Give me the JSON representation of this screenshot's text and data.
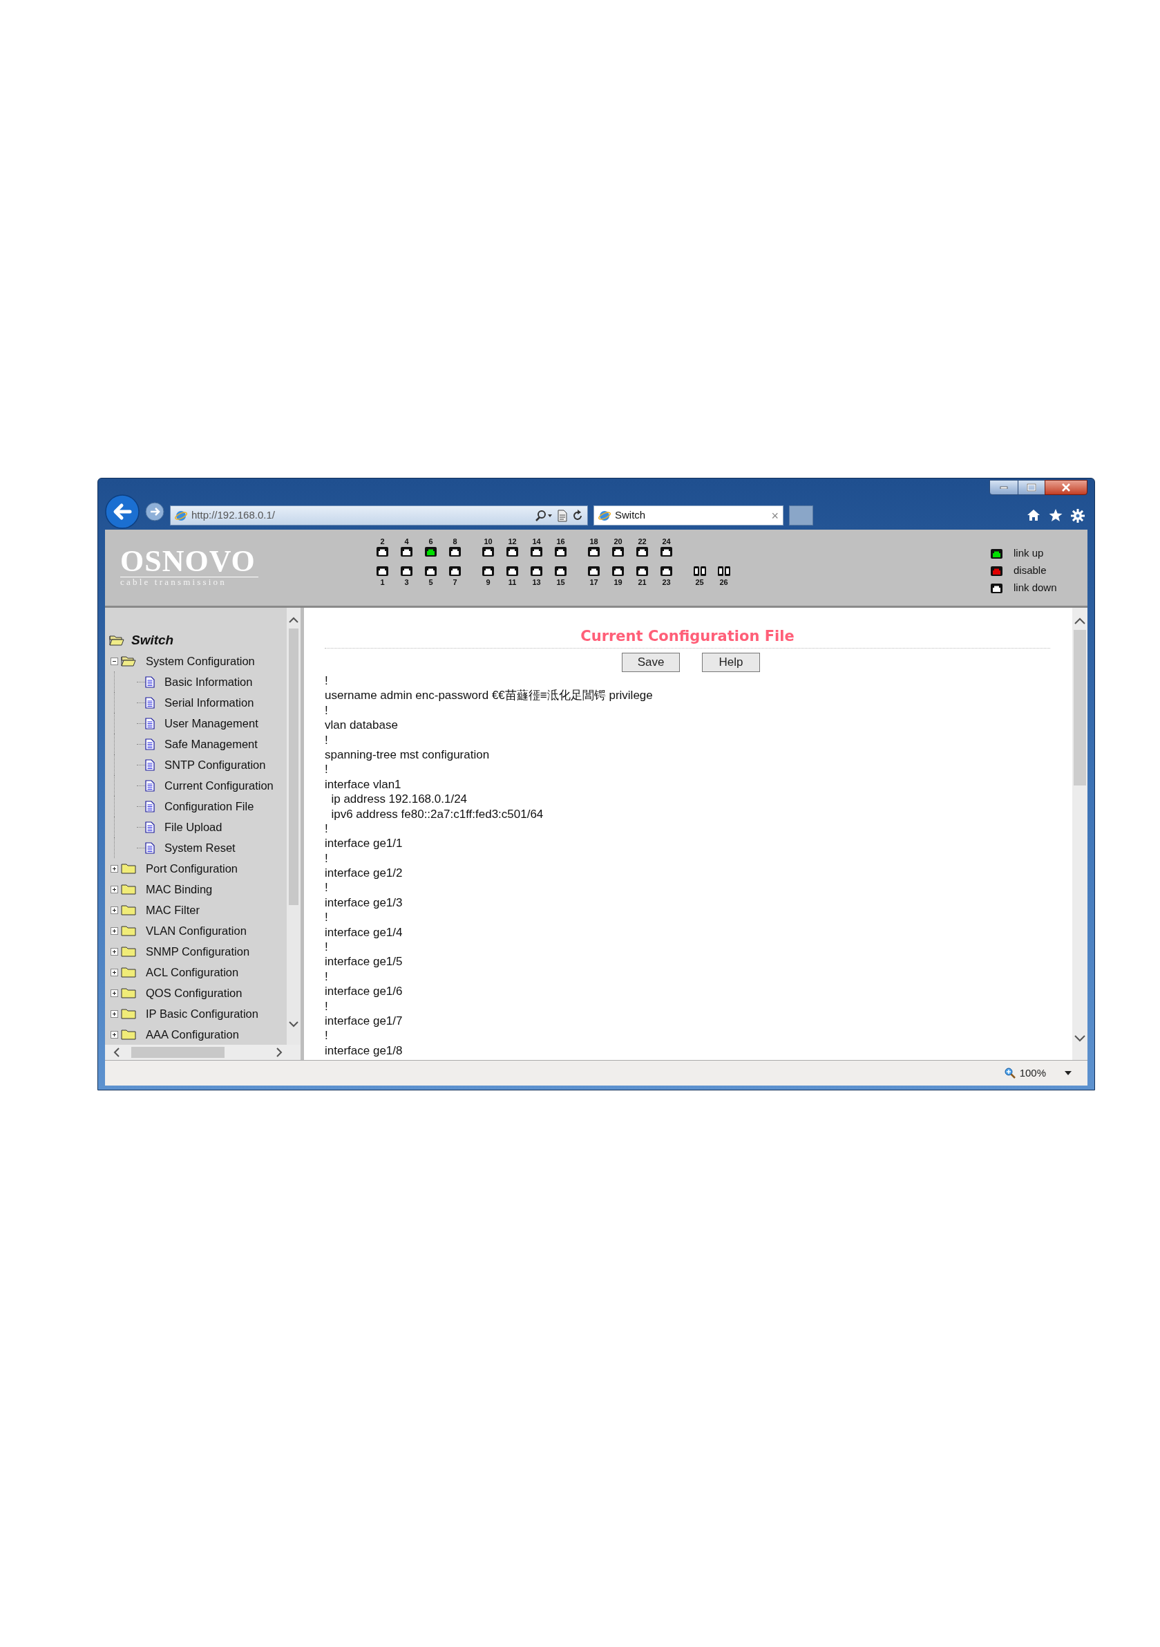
{
  "browser": {
    "address": "http://192.168.0.1/",
    "tabs": [
      {
        "title": "Switch",
        "close": "×"
      }
    ],
    "zoom": "100%"
  },
  "header": {
    "logo": "OSNOVO",
    "logo_tagline": "cable transmission",
    "port_columns": [
      {
        "kind": "rj45",
        "top": {
          "label": "2",
          "link_up": false
        },
        "bottom": {
          "label": "1",
          "link_up": false
        }
      },
      {
        "kind": "rj45",
        "top": {
          "label": "4",
          "link_up": false
        },
        "bottom": {
          "label": "3",
          "link_up": false
        }
      },
      {
        "kind": "rj45",
        "top": {
          "label": "6",
          "link_up": true
        },
        "bottom": {
          "label": "5",
          "link_up": false
        }
      },
      {
        "kind": "rj45",
        "top": {
          "label": "8",
          "link_up": false
        },
        "bottom": {
          "label": "7",
          "link_up": false
        }
      },
      {
        "kind": "rj45",
        "top": {
          "label": "10",
          "link_up": false
        },
        "bottom": {
          "label": "9",
          "link_up": false
        }
      },
      {
        "kind": "rj45",
        "top": {
          "label": "12",
          "link_up": false
        },
        "bottom": {
          "label": "11",
          "link_up": false
        }
      },
      {
        "kind": "rj45",
        "top": {
          "label": "14",
          "link_up": false
        },
        "bottom": {
          "label": "13",
          "link_up": false
        }
      },
      {
        "kind": "rj45",
        "top": {
          "label": "16",
          "link_up": false
        },
        "bottom": {
          "label": "15",
          "link_up": false
        }
      },
      {
        "kind": "rj45",
        "top": {
          "label": "18",
          "link_up": false
        },
        "bottom": {
          "label": "17",
          "link_up": false
        }
      },
      {
        "kind": "rj45",
        "top": {
          "label": "20",
          "link_up": false
        },
        "bottom": {
          "label": "19",
          "link_up": false
        }
      },
      {
        "kind": "rj45",
        "top": {
          "label": "22",
          "link_up": false
        },
        "bottom": {
          "label": "21",
          "link_up": false
        }
      },
      {
        "kind": "rj45",
        "top": {
          "label": "24",
          "link_up": false
        },
        "bottom": {
          "label": "23",
          "link_up": false
        }
      },
      {
        "kind": "sfp",
        "bottom": {
          "label": "25",
          "link_up": false
        }
      },
      {
        "kind": "sfp",
        "bottom": {
          "label": "26",
          "link_up": false
        }
      }
    ],
    "legend": [
      {
        "color": "#00e000",
        "label": "link up"
      },
      {
        "color": "#e00000",
        "label": "disable"
      },
      {
        "color": "#ffffff",
        "label": "link down"
      }
    ]
  },
  "sidebar": {
    "tree": {
      "label": "Switch",
      "expanded": true,
      "children": [
        {
          "label": "System Configuration",
          "expanded": true,
          "children": [
            {
              "label": "Basic Information"
            },
            {
              "label": "Serial Information"
            },
            {
              "label": "User Management"
            },
            {
              "label": "Safe Management"
            },
            {
              "label": "SNTP Configuration"
            },
            {
              "label": "Current Configuration"
            },
            {
              "label": "Configuration File"
            },
            {
              "label": "File Upload"
            },
            {
              "label": "System Reset"
            }
          ]
        },
        {
          "label": "Port Configuration",
          "expanded": false
        },
        {
          "label": "MAC Binding",
          "expanded": false
        },
        {
          "label": "MAC Filter",
          "expanded": false
        },
        {
          "label": "VLAN Configuration",
          "expanded": false
        },
        {
          "label": "SNMP Configuration",
          "expanded": false
        },
        {
          "label": "ACL Configuration",
          "expanded": false
        },
        {
          "label": "QOS Configuration",
          "expanded": false
        },
        {
          "label": "IP Basic Configuration",
          "expanded": false
        },
        {
          "label": "AAA Configuration",
          "expanded": false
        }
      ]
    }
  },
  "content": {
    "title": "Current Configuration File",
    "buttons": [
      "Save",
      "Help"
    ],
    "lines": [
      "!",
      "username admin enc-password €€苗蘕徰≡泜化足閶锷 privilege",
      "!",
      "vlan database",
      "!",
      "spanning-tree mst configuration",
      "!",
      "interface vlan1",
      "  ip address 192.168.0.1/24",
      "  ipv6 address fe80::2a7:c1ff:fed3:c501/64",
      "!",
      "interface ge1/1",
      "!",
      "interface ge1/2",
      "!",
      "interface ge1/3",
      "!",
      "interface ge1/4",
      "!",
      "interface ge1/5",
      "!",
      "interface ge1/6",
      "!",
      "interface ge1/7",
      "!",
      "interface ge1/8"
    ]
  }
}
